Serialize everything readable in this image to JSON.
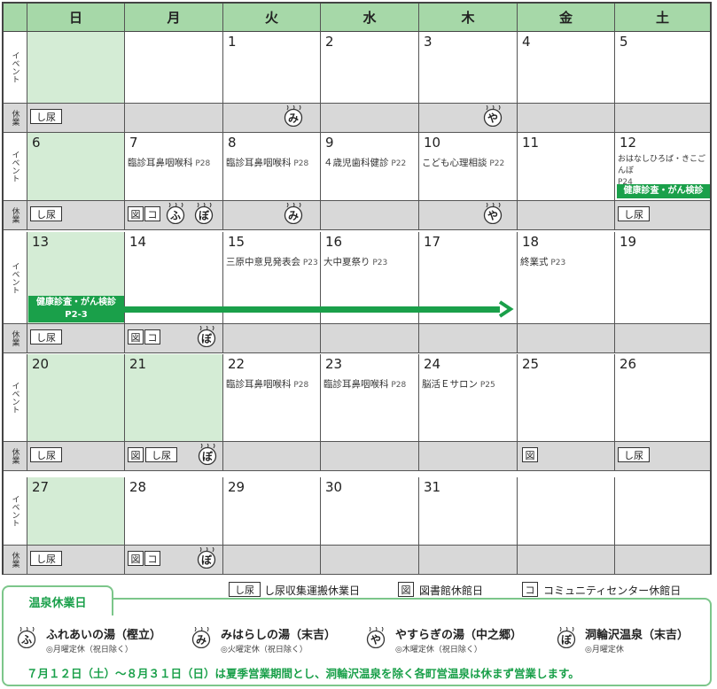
{
  "weekdays": [
    "日",
    "月",
    "火",
    "水",
    "木",
    "金",
    "土"
  ],
  "row_labels": {
    "event": "イベント",
    "kyu": "休業"
  },
  "icons": {
    "shinyo": "し尿",
    "library": "図",
    "community": "コ",
    "fureai": "ふ",
    "mihara": "み",
    "yasuragi": "や",
    "dowa": "ぼ"
  },
  "weeks": [
    {
      "days": [
        "",
        "",
        "1",
        "2",
        "3",
        "4",
        "5"
      ]
    },
    {
      "days": [
        "6",
        "7",
        "8",
        "9",
        "10",
        "11",
        "12"
      ]
    },
    {
      "days": [
        "13",
        "14",
        "15",
        "16",
        "17",
        "18",
        "19"
      ]
    },
    {
      "days": [
        "20",
        "21",
        "22",
        "23",
        "24",
        "25",
        "26"
      ]
    },
    {
      "days": [
        "27",
        "28",
        "29",
        "30",
        "31",
        "",
        ""
      ]
    }
  ],
  "events": {
    "w1_mon": {
      "text": "臨診耳鼻咽喉科",
      "page": "P28"
    },
    "w1_tue": {
      "text": "臨診耳鼻咽喉科",
      "page": "P28"
    },
    "w1_wed": {
      "text": "４歳児歯科健診",
      "page": "P22"
    },
    "w1_thu": {
      "text": "こども心理相談",
      "page": "P22"
    },
    "w1_sat": {
      "text": "おはなしひろば・きこごんぼ",
      "page": "P24"
    },
    "w1_sat_bar": "健康診査・がん検診",
    "w2_tue": {
      "text": "三原中意見発表会",
      "page": "P23"
    },
    "w2_wed": {
      "text": "大中夏祭り",
      "page": "P23"
    },
    "w2_fri": {
      "text": "終業式",
      "page": "P23"
    },
    "w2_sun_bar": "健康診査・がん検診",
    "w2_sun_bar_page": "P2-3",
    "w3_tue": {
      "text": "臨診耳鼻咽喉科",
      "page": "P28"
    },
    "w3_wed": {
      "text": "臨診耳鼻咽喉科",
      "page": "P28"
    },
    "w3_thu": {
      "text": "脳活Ｅサロン",
      "page": "P25"
    }
  },
  "legend": {
    "shinyo": "し尿収集運搬休業日",
    "library": "図書館休館日",
    "community": "コミュニティセンター休館日"
  },
  "onsen": {
    "title": "温泉休業日",
    "items": [
      {
        "icon": "ふ",
        "name": "ふれあいの湯（樫立）",
        "note": "◎月曜定休（祝日除く）"
      },
      {
        "icon": "み",
        "name": "みはらしの湯（末吉）",
        "note": "◎火曜定休（祝日除く）"
      },
      {
        "icon": "や",
        "name": "やすらぎの湯（中之郷）",
        "note": "◎木曜定休（祝日除く）"
      },
      {
        "icon": "ぼ",
        "name": "洞輪沢温泉（末吉）",
        "note": "◎月曜定休"
      }
    ],
    "summer": "７月１２日（土）～８月３１日（日）は夏季営業期間とし、洞輪沢温泉を除く各町営温泉は休まず営業します。"
  },
  "colors": {
    "green": "#1aa04a",
    "light_green": "#d4ecd5",
    "header_green": "#a6d8a8",
    "gray": "#d8d8d8"
  }
}
